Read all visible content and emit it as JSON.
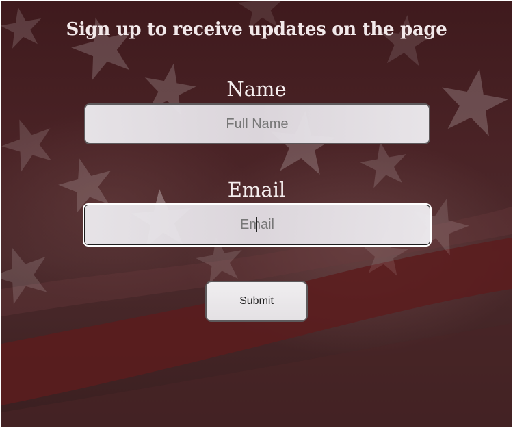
{
  "page": {
    "heading": "Sign up to receive updates on the page"
  },
  "form": {
    "name_label": "Name",
    "name_placeholder": "Full Name",
    "name_value": "",
    "email_label": "Email",
    "email_placeholder": "Email",
    "email_value": "",
    "submit_label": "Submit"
  },
  "background": {
    "description_icon": "american-flag-background",
    "colors": {
      "dark_maroon": "#3f1a1d",
      "red_stripe": "#5a1c1c",
      "star": "#ffffff",
      "heading_text": "#f2e9ea"
    }
  }
}
